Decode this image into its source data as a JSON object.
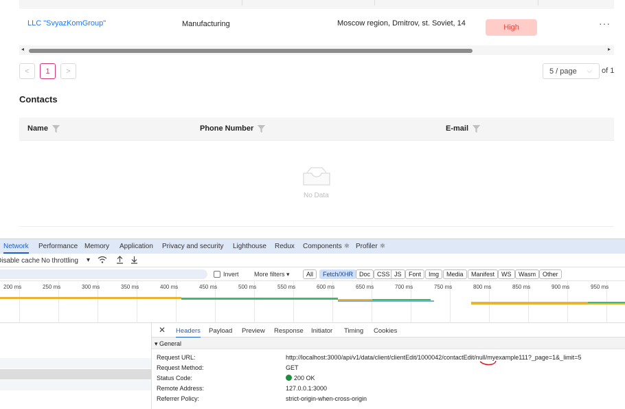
{
  "companies_table": {
    "row": {
      "name": "LLC \"SvyazKomGroup\"",
      "industry": "Manufacturing",
      "address": "Moscow region, Dmitrov, st. Soviet, 14",
      "priority": "High",
      "actions_icon": "ellipsis-icon"
    }
  },
  "pagination": {
    "prev_icon": "chevron-left-icon",
    "current_page": "1",
    "next_icon": "chevron-right-icon",
    "page_size": "5 / page",
    "of_text": "of 1"
  },
  "contacts": {
    "title": "Contacts",
    "columns": [
      "Name",
      "Phone Number",
      "E-mail"
    ],
    "empty_text": "No Data"
  },
  "devtools": {
    "tabs": [
      "Network",
      "Performance",
      "Memory",
      "Application",
      "Privacy and security",
      "Lighthouse",
      "Redux",
      "Components ⚛",
      "Profiler ⚛"
    ],
    "active_tab": "Network",
    "toolbar": {
      "disable_cache": "Disable cache",
      "throttling": "No throttling"
    },
    "filters": {
      "invert": "Invert",
      "more_filters": "More filters ▾",
      "types": [
        "All",
        "Fetch/XHR",
        "Doc",
        "CSS",
        "JS",
        "Font",
        "Img",
        "Media",
        "Manifest",
        "WS",
        "Wasm",
        "Other"
      ],
      "active_type": "Fetch/XHR"
    },
    "timeline_ticks": [
      "200 ms",
      "250 ms",
      "300 ms",
      "350 ms",
      "400 ms",
      "450 ms",
      "500 ms",
      "550 ms",
      "600 ms",
      "650 ms",
      "700 ms",
      "750 ms",
      "800 ms",
      "850 ms",
      "900 ms",
      "950 ms"
    ],
    "panel": {
      "close_icon": "close-icon",
      "tabs": [
        "Headers",
        "Payload",
        "Preview",
        "Response",
        "Initiator",
        "Timing",
        "Cookies"
      ],
      "active_tab": "Headers",
      "section": "▾ General",
      "rows": [
        {
          "label": "Request URL:",
          "value": "http://localhost:3000/api/v1/data/client/clientEdit/1000042/contactEdit/null/myexample111?_page=1&_limit=5"
        },
        {
          "label": "Request Method:",
          "value": "GET"
        },
        {
          "label": "Status Code:",
          "value": "200 OK"
        },
        {
          "label": "Remote Address:",
          "value": "127.0.0.1:3000"
        },
        {
          "label": "Referrer Policy:",
          "value": "strict-origin-when-cross-origin"
        }
      ]
    }
  },
  "colors": {
    "link": "#1677ff",
    "priority_bg": "#ffccc7",
    "priority_text": "#e8473d",
    "pagination_active": "#d4357a",
    "devtools_active": "#1a5fd1",
    "status_ok": "#1e8e3e"
  }
}
